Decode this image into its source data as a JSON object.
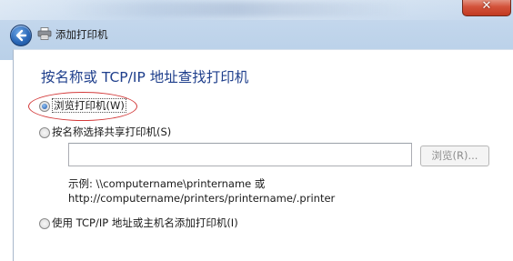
{
  "window": {
    "title": "添加打印机",
    "close_glyph": "✕"
  },
  "main": {
    "heading": "按名称或 TCP/IP 地址查找打印机",
    "options": [
      {
        "label": "浏览打印机(W)",
        "checked": true
      },
      {
        "label": "按名称选择共享打印机(S)",
        "checked": false
      },
      {
        "label": "使用 TCP/IP 地址或主机名添加打印机(I)",
        "checked": false
      }
    ],
    "share_input": {
      "value": ""
    },
    "browse_button": "浏览(R)...",
    "example_line1": "示例: \\\\computername\\printername 或",
    "example_line2": "http://computername/printers/printername/.printer"
  },
  "colors": {
    "heading": "#1f3f8c",
    "highlight": "#d33a3a"
  },
  "icons": {
    "back": "back-arrow-icon",
    "printer": "printer-icon",
    "close": "close-icon"
  }
}
